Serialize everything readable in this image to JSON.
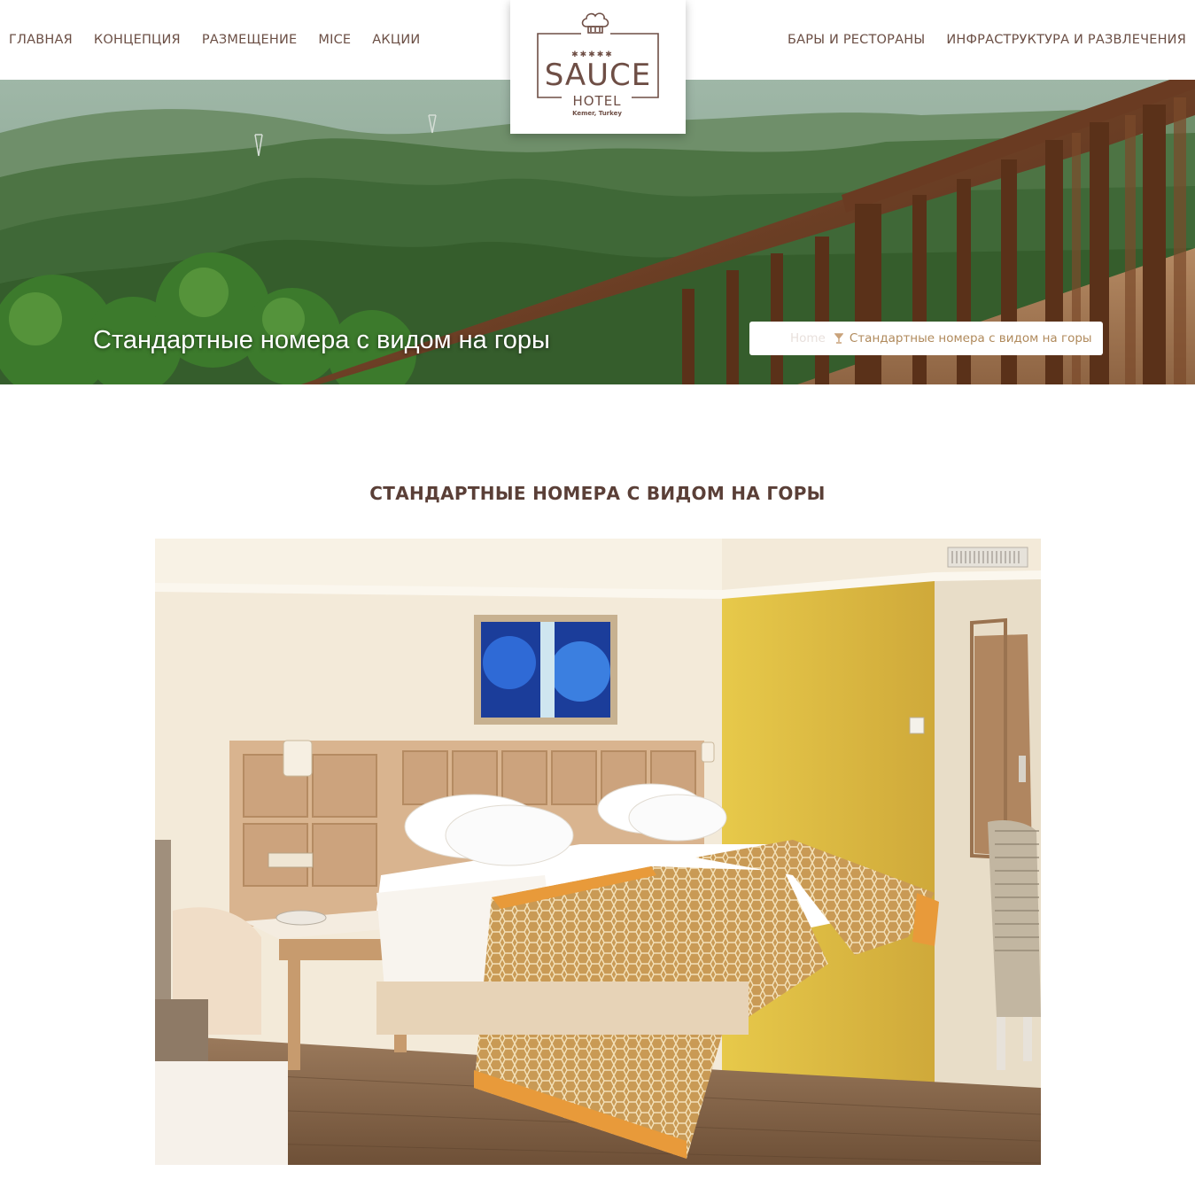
{
  "nav": {
    "left": [
      "ГЛАВНАЯ",
      "КОНЦЕПЦИЯ",
      "РАЗМЕЩЕНИЕ",
      "MICE",
      "АКЦИИ"
    ],
    "right": [
      "БАРЫ И РЕСТОРАНЫ",
      "ИНФРАСТРУКТУРА И РАЗВЛЕЧЕНИЯ"
    ]
  },
  "logo": {
    "stars": "✱✱✱✱✱",
    "name": "SAUCE",
    "sub": "HOTEL",
    "location": "Kemer, Turkey"
  },
  "hero": {
    "title": "Стандартные номера с видом на горы"
  },
  "breadcrumb": {
    "home": "Home",
    "current": "Стандартные номера с видом на горы"
  },
  "page": {
    "heading": "СТАНДАРТНЫЕ НОМЕРА С ВИДОМ НА ГОРЫ"
  },
  "colors": {
    "nav_text": "#6b4f45",
    "heading": "#5a3f37",
    "breadcrumb_accent": "#b08a5c",
    "logo_brown": "#6e4e45"
  }
}
